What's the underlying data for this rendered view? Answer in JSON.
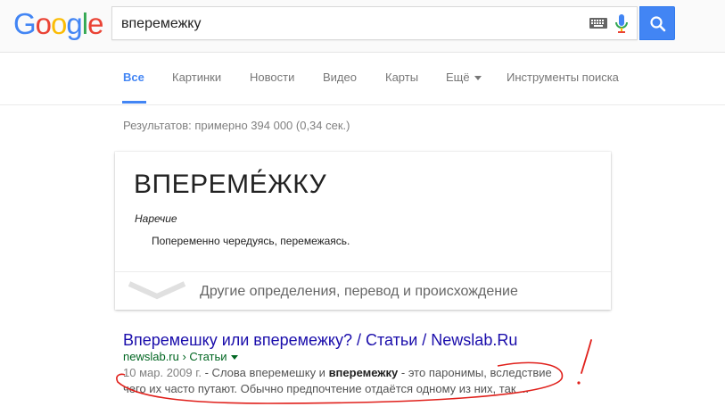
{
  "header": {
    "logo_letters": [
      "G",
      "o",
      "o",
      "g",
      "l",
      "e"
    ],
    "logo_colors": [
      "#4285f4",
      "#ea4335",
      "#fbbc05",
      "#4285f4",
      "#34a853",
      "#ea4335"
    ],
    "search_value": "вперемежку",
    "keyboard_icon": "keyboard-icon",
    "mic_icon": "mic-icon",
    "search_icon": "search-icon"
  },
  "tabs": [
    {
      "label": "Все",
      "active": true
    },
    {
      "label": "Картинки"
    },
    {
      "label": "Новости"
    },
    {
      "label": "Видео"
    },
    {
      "label": "Карты"
    },
    {
      "label": "Ещё"
    },
    {
      "label": "Инструменты поиска"
    }
  ],
  "result_stats": "Результатов: примерно 394 000 (0,34 сек.)",
  "dictionary": {
    "word": "ВПЕРЕМЕ́ЖКУ",
    "part_of_speech": "Наречие",
    "definition": "Попеременно чередуясь, перемежаясь.",
    "more_label": "Другие определения, перевод и происхождение"
  },
  "result": {
    "title": "Вперемешку или вперемежку? / Статьи / Newslab.Ru",
    "url": "newslab.ru › Статьи",
    "snippet_date": "10 мар. 2009 г.",
    "snippet_part1": " - Слова вперемешку и ",
    "snippet_bold": "вперемежку",
    "snippet_part2": " - это паронимы, вследствие чего их часто путают. Обычно предпочтение отдаётся одному из них, так ..."
  },
  "colors": {
    "accent_blue": "#4285f4",
    "link": "#1a0dab",
    "url_green": "#006621",
    "annotation_red": "#e0201b"
  }
}
